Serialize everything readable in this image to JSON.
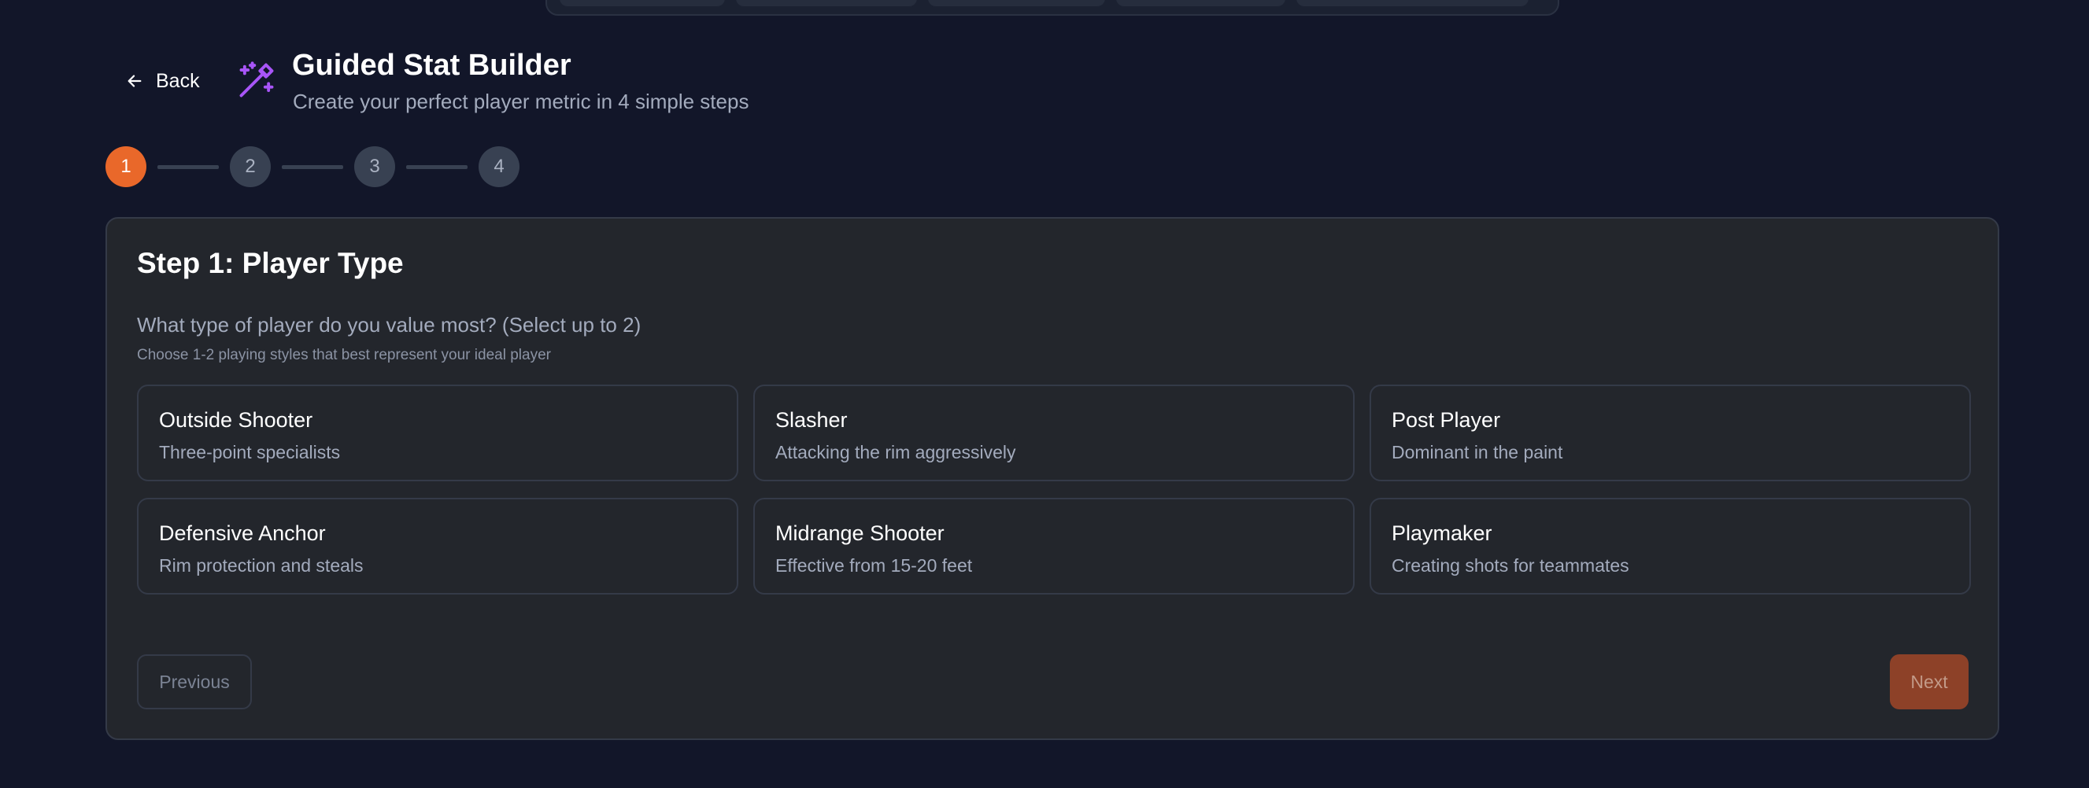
{
  "header": {
    "back_label": "Back",
    "title": "Guided Stat Builder",
    "subtitle": "Create your perfect player metric in 4 simple steps"
  },
  "stepper": {
    "steps": [
      "1",
      "2",
      "3",
      "4"
    ],
    "active_step": 1
  },
  "step1": {
    "title": "Step 1: Player Type",
    "question": "What type of player do you value most? (Select up to 2)",
    "hint": "Choose 1-2 playing styles that best represent your ideal player",
    "options": [
      {
        "label": "Outside Shooter",
        "desc": "Three-point specialists"
      },
      {
        "label": "Slasher",
        "desc": "Attacking the rim aggressively"
      },
      {
        "label": "Post Player",
        "desc": "Dominant in the paint"
      },
      {
        "label": "Defensive Anchor",
        "desc": "Rim protection and steals"
      },
      {
        "label": "Midrange Shooter",
        "desc": "Effective from 15-20 feet"
      },
      {
        "label": "Playmaker",
        "desc": "Creating shots for teammates"
      }
    ]
  },
  "footer": {
    "previous_label": "Previous",
    "next_label": "Next"
  },
  "colors": {
    "background": "#121629",
    "card": "#23262c",
    "accent": "#e9682a",
    "wand_icon": "#a855f7"
  },
  "icons": {
    "back": "arrow-left-icon",
    "wand": "magic-wand-icon"
  }
}
